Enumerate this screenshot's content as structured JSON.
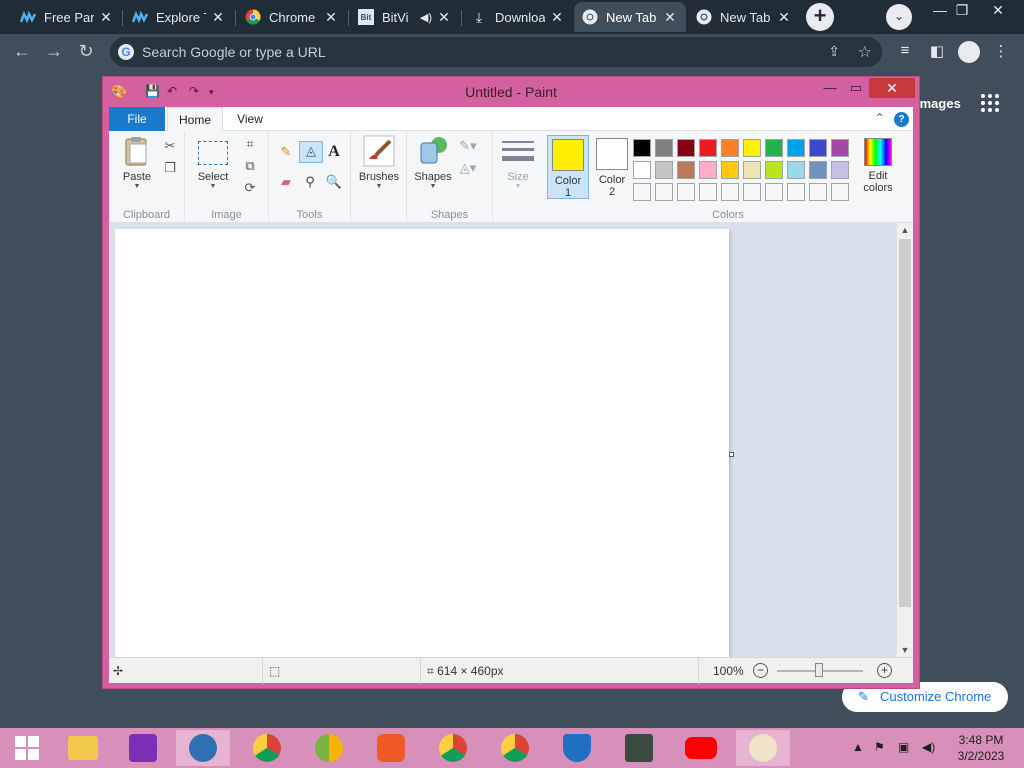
{
  "browser": {
    "tabs": [
      {
        "title": "Free Part",
        "favicon": "lens-m-icon"
      },
      {
        "title": "Explore T",
        "favicon": "lens-m-icon"
      },
      {
        "title": "Chrome",
        "favicon": "chrome-icon"
      },
      {
        "title": "BitVi",
        "favicon": "bitview-icon"
      },
      {
        "title": "Downloa",
        "favicon": "download-icon"
      },
      {
        "title": "New Tab",
        "favicon": "chrome-icon"
      },
      {
        "title": "New Tab",
        "favicon": "chrome-icon"
      }
    ],
    "omnibox_placeholder": "Search Google or type a URL",
    "page_images_link": "Images",
    "customize_label": "Customize Chrome"
  },
  "paint": {
    "title": "Untitled - Paint",
    "tabs": {
      "file": "File",
      "home": "Home",
      "view": "View"
    },
    "ribbon": {
      "clipboard": {
        "label": "Clipboard",
        "paste": "Paste"
      },
      "image": {
        "label": "Image",
        "select": "Select"
      },
      "tools": {
        "label": "Tools"
      },
      "brushes": "Brushes",
      "shapes": {
        "label": "Shapes",
        "shapes_btn": "Shapes"
      },
      "size": "Size",
      "colors": {
        "label": "Colors",
        "color1_label": "Color",
        "color1_num": "1",
        "color2_label": "Color",
        "color2_num": "2",
        "edit_label": "Edit",
        "edit_label2": "colors",
        "color1": "#ffee00",
        "color2": "#ffffff",
        "palette": [
          "#000000",
          "#7f7f7f",
          "#880015",
          "#ed1c24",
          "#ff7f27",
          "#fff200",
          "#22b14c",
          "#00a2e8",
          "#3f48cc",
          "#a349a4",
          "#ffffff",
          "#c3c3c3",
          "#b97a57",
          "#ffaec9",
          "#ffc90e",
          "#efe4b0",
          "#b5e61d",
          "#99d9ea",
          "#7092be",
          "#c8bfe7",
          "#f5f6f7",
          "#f5f6f7",
          "#f5f6f7",
          "#f5f6f7",
          "#f5f6f7",
          "#f5f6f7",
          "#f5f6f7",
          "#f5f6f7",
          "#f5f6f7",
          "#f5f6f7"
        ]
      }
    },
    "status": {
      "dimensions": "614 × 460px",
      "zoom": "100%"
    }
  },
  "taskbar": {
    "time": "3:48 PM",
    "date": "3/2/2023"
  },
  "colors": {
    "paint_frame": "#d4619f",
    "taskbar": "#d790b9",
    "chrome_dark": "#202d36",
    "accent_blue": "#1979ca"
  }
}
